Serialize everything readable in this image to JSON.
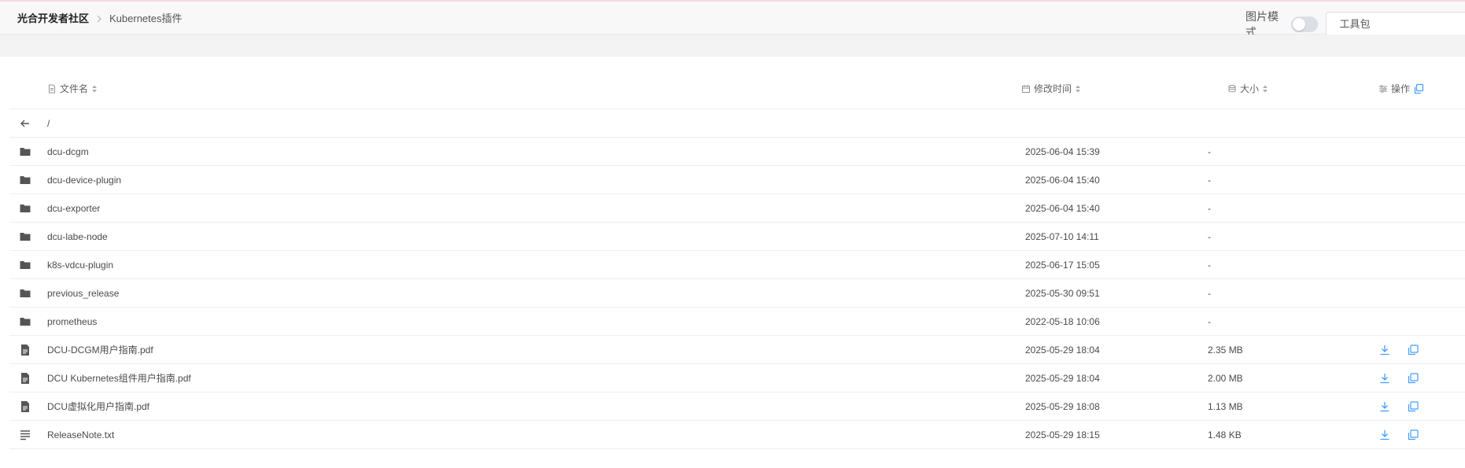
{
  "breadcrumb": {
    "root": "光合开发者社区",
    "current": "Kubernetes插件"
  },
  "header_tools": {
    "image_mode_label": "图片模式",
    "image_mode_on": false,
    "toolbox_value": "工具包"
  },
  "table": {
    "columns": {
      "name": "文件名",
      "modified": "修改时间",
      "size": "大小",
      "actions": "操作"
    },
    "parent_path": "/",
    "rows": [
      {
        "type": "folder",
        "name": "dcu-dcgm",
        "modified": "2025-06-04 15:39",
        "size": "-"
      },
      {
        "type": "folder",
        "name": "dcu-device-plugin",
        "modified": "2025-06-04 15:40",
        "size": "-"
      },
      {
        "type": "folder",
        "name": "dcu-exporter",
        "modified": "2025-06-04 15:40",
        "size": "-"
      },
      {
        "type": "folder",
        "name": "dcu-labe-node",
        "modified": "2025-07-10 14:11",
        "size": "-"
      },
      {
        "type": "folder",
        "name": "k8s-vdcu-plugin",
        "modified": "2025-06-17 15:05",
        "size": "-"
      },
      {
        "type": "folder",
        "name": "previous_release",
        "modified": "2025-05-30 09:51",
        "size": "-"
      },
      {
        "type": "folder",
        "name": "prometheus",
        "modified": "2022-05-18 10:06",
        "size": "-"
      },
      {
        "type": "pdf",
        "name": "DCU-DCGM用户指南.pdf",
        "modified": "2025-05-29 18:04",
        "size": "2.35 MB"
      },
      {
        "type": "pdf",
        "name": "DCU Kubernetes组件用户指南.pdf",
        "modified": "2025-05-29 18:04",
        "size": "2.00 MB"
      },
      {
        "type": "pdf",
        "name": "DCU虚拟化用户指南.pdf",
        "modified": "2025-05-29 18:08",
        "size": "1.13 MB"
      },
      {
        "type": "text",
        "name": "ReleaseNote.txt",
        "modified": "2025-05-29 18:15",
        "size": "1.48 KB"
      }
    ]
  },
  "icons": {
    "folder": "folder-icon",
    "pdf": "file-document-icon",
    "text": "text-file-icon",
    "back": "back-arrow-icon",
    "download": "download-icon",
    "copy": "copy-icon"
  },
  "colors": {
    "accent": "#409eff",
    "icon_dark": "#555555",
    "header_bg": "#f8f8f9",
    "top_line": "#f5d7df"
  }
}
